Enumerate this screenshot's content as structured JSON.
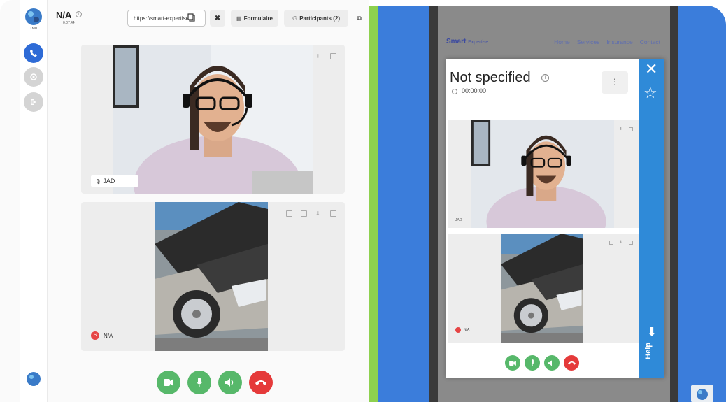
{
  "left_app": {
    "title": "N/A",
    "timer": "0:07:44",
    "url": "https://smart-expertise",
    "formulaire_label": "Formulaire",
    "participants_label": "Participants (2)",
    "participant_name": "JAD",
    "participant2_name": "N/A",
    "avatar_initial": "S",
    "logo_text": "TMU"
  },
  "widget": {
    "brand": "Smart",
    "brand_suffix": "Expertise",
    "nav": [
      "Home",
      "Services",
      "Insurance",
      "Contact"
    ],
    "title": "Not specified",
    "timer": "00:00:00",
    "menu": "⋮",
    "participant_name": "JAD",
    "participant2_name": "N/A",
    "help_label": "Help"
  },
  "colors": {
    "accent_blue": "#3b7ddb",
    "green": "#57b86a",
    "red": "#e53a3a",
    "lime": "#8ed14f"
  },
  "icons": {
    "rail_call": "phone-icon",
    "rail_settings": "gear-icon",
    "rail_logout": "logout-icon"
  }
}
